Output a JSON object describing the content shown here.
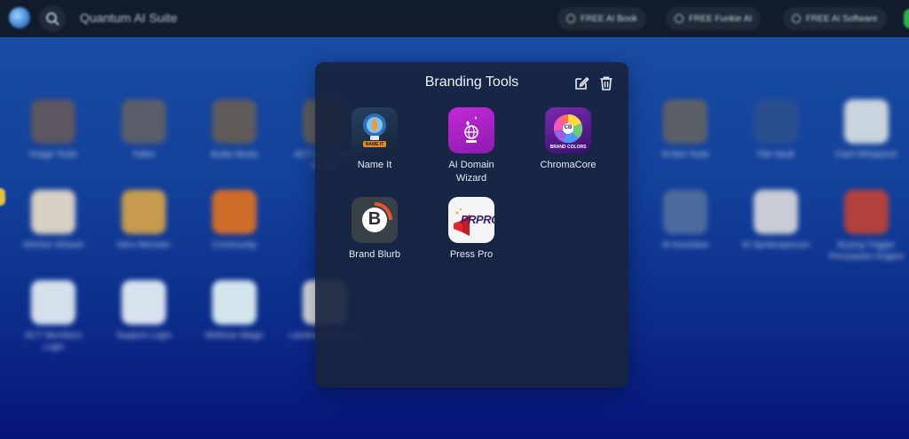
{
  "topbar": {
    "title": "Quantum AI Suite",
    "pills": [
      {
        "label": "FREE AI Book",
        "icon": "gear-icon"
      },
      {
        "label": "FREE Funkie AI",
        "icon": "gear-icon"
      },
      {
        "label": "FREE AI Software",
        "icon": "gear-icon"
      }
    ]
  },
  "background_apps": [
    {
      "label": "Image Tools",
      "color": "#5d5560"
    },
    {
      "label": "Video",
      "color": "#5a5d6a"
    },
    {
      "label": "Audio Music",
      "color": "#5e5a58"
    },
    {
      "label": "ACT Command Center",
      "color": "#5b5d60"
    },
    {
      "label": "AI Bot Tools",
      "color": "#5b6068"
    },
    {
      "label": "File Vault",
      "color": "#2a4f8f"
    },
    {
      "label": "Card Whisperer",
      "color": "#c9d4dc"
    },
    {
      "label": "Kitchen Wizard",
      "color": "#d7d0c4"
    },
    {
      "label": "Hero Monster",
      "color": "#c69a4f"
    },
    {
      "label": "Community",
      "color": "#d06c2a"
    },
    {
      "label": "AI Assistant",
      "color": "#4d6a9d"
    },
    {
      "label": "AI Spokesperson",
      "color": "#c8ccd4"
    },
    {
      "label": "Buying Trigger Persuasion Engine",
      "color": "#b3403d"
    },
    {
      "label": "ACT Members Login",
      "color": "#d4e0ec"
    },
    {
      "label": "Support Login",
      "color": "#d8e2ee"
    },
    {
      "label": "Webinar Magic",
      "color": "#d3e6ee"
    },
    {
      "label": "Landing Page Pro",
      "color": "#d5dbe2"
    }
  ],
  "folder": {
    "title": "Branding Tools",
    "apps": [
      {
        "label": "Name It"
      },
      {
        "label": "AI Domain Wizard"
      },
      {
        "label": "ChromaCore"
      },
      {
        "label": "Brand Blurb"
      },
      {
        "label": "Press Pro"
      }
    ],
    "chroma_badge": "CB",
    "chroma_caption": "BRAND COLORS",
    "nameit_caption": "NAME IT",
    "presspro_text": "PRPRO",
    "brandblurb_letter": "B"
  }
}
